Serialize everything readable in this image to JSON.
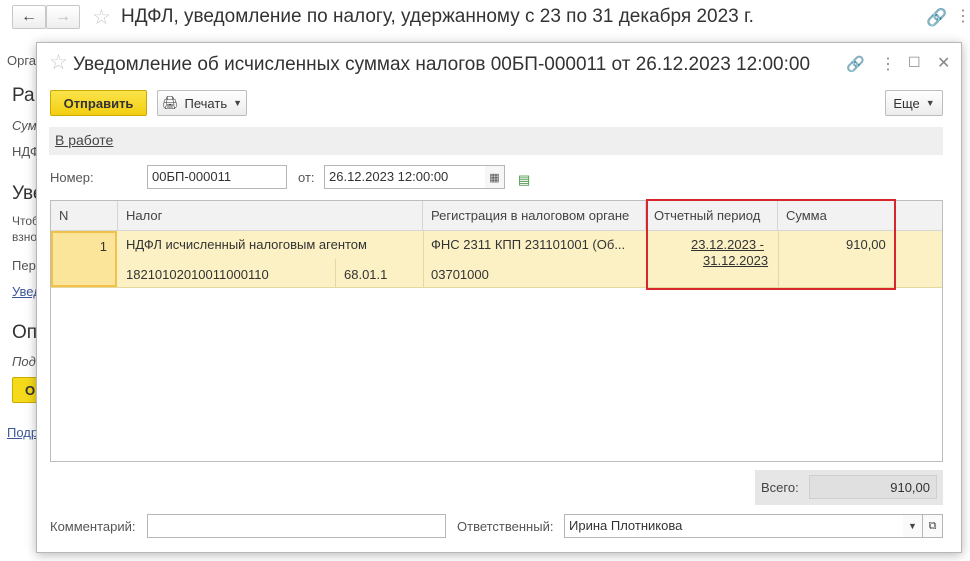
{
  "background": {
    "title": "НДФЛ, уведомление по налогу, удержанному с 23 по 31 декабря 2023 г.",
    "fragments": [
      "Орга",
      "Ра",
      "Сум",
      "НДФ",
      "Уве",
      "Чтоб",
      "взно",
      "Пер",
      "Увед",
      "Оп",
      "Под",
      "О",
      "Подр"
    ]
  },
  "modal": {
    "title": "Уведомление об исчисленных суммах налогов 00БП-000011 от 26.12.2023 12:00:00",
    "toolbar": {
      "send_label": "Отправить",
      "print_label": "Печать",
      "more_label": "Еще"
    },
    "status_link": "В работе",
    "number_label": "Номер:",
    "number_value": "00БП-000011",
    "date_label": "от:",
    "date_value": "26.12.2023 12:00:00",
    "table": {
      "columns": [
        "N",
        "Налог",
        "Регистрация в налоговом органе",
        "Отчетный период",
        "Сумма"
      ],
      "rows": [
        {
          "n": "1",
          "tax": "НДФЛ исчисленный налоговым агентом",
          "kbk": "18210102010011000110",
          "account": "68.01.1",
          "registration": "ФНС 2311 КПП 231101001 (Об...",
          "oktmo": "03701000",
          "period_line1": "23.12.2023 -",
          "period_line2": "31.12.2023",
          "amount": "910,00"
        }
      ]
    },
    "total_label": "Всего:",
    "total_value": "910,00",
    "comment_label": "Комментарий:",
    "comment_value": "",
    "responsible_label": "Ответственный:",
    "responsible_value": "Ирина Плотникова"
  },
  "colors": {
    "primary_button": "#f3cf12",
    "selected_row": "#fbf1c4",
    "highlight_box": "#d7262c"
  },
  "icons": [
    "back-arrow-icon",
    "forward-arrow-icon",
    "star-icon",
    "link-icon",
    "more-vertical-icon",
    "maximize-icon",
    "close-icon",
    "printer-icon",
    "calendar-icon",
    "green-list-icon",
    "open-form-icon"
  ]
}
